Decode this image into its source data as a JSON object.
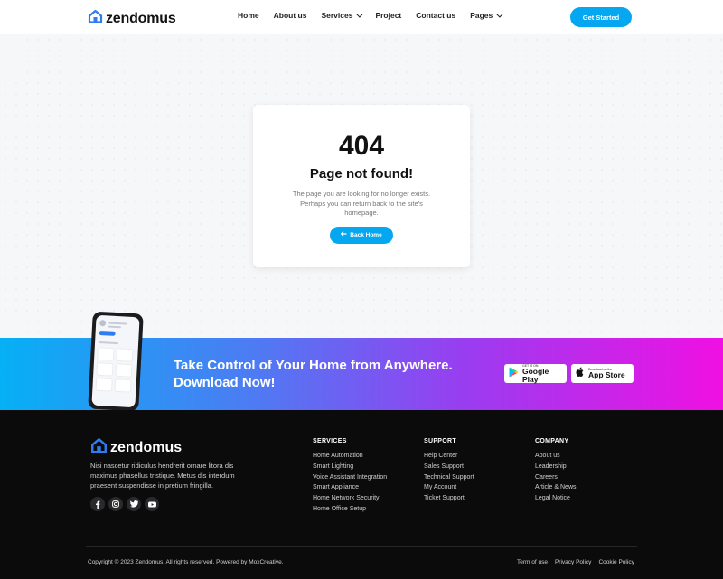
{
  "header": {
    "brand": "zendomus",
    "nav": [
      {
        "label": "Home"
      },
      {
        "label": "About us"
      },
      {
        "label": "Services",
        "has_dropdown": true
      },
      {
        "label": "Project"
      },
      {
        "label": "Contact us"
      },
      {
        "label": "Pages",
        "has_dropdown": true
      }
    ],
    "cta": "Get Started"
  },
  "error": {
    "code": "404",
    "title": "Page not found!",
    "description": "The page you are looking for no longer exists. Perhaps you can return back to the site's homepage.",
    "button": "Back Home",
    "button_icon": "arrow-left-icon"
  },
  "banner": {
    "line1": "Take Control of Your Home from Anywhere.",
    "line2": "Download Now!",
    "google_play": {
      "small": "GET IT ON",
      "big": "Google Play"
    },
    "app_store": {
      "small": "Download on the",
      "big": "App Store"
    }
  },
  "footer": {
    "brand": "zendomus",
    "description": "Nisi nascetur ridiculus hendrerit ornare litora dis maximus phasellus tristique. Metus dis interdum praesent suspendisse in pretium fringilla.",
    "socials": [
      "facebook-icon",
      "instagram-icon",
      "twitter-icon",
      "youtube-icon"
    ],
    "columns": [
      {
        "title": "SERVICES",
        "links": [
          "Home Automation",
          "Smart Lighting",
          "Voice Assistant Integration",
          "Smart Appliance",
          "Home Network Security",
          "Home Office Setup"
        ]
      },
      {
        "title": "SUPPORT",
        "links": [
          "Help Center",
          "Sales Support",
          "Technical Support",
          "My Account",
          "Ticket Support"
        ]
      },
      {
        "title": "COMPANY",
        "links": [
          "About us",
          "Leadership",
          "Careers",
          "Article & News",
          "Legal Notice"
        ]
      }
    ],
    "copyright": "Copyright © 2023 Zendomus, All rights reserved. Powered by MoxCreative.",
    "legal": [
      "Term of use",
      "Privacy Policy",
      "Cookie Policy"
    ]
  },
  "colors": {
    "accent": "#05a8f0",
    "footer_bg": "#0b0b0c",
    "gradient_start": "#06b0f5",
    "gradient_end": "#f010e3"
  }
}
